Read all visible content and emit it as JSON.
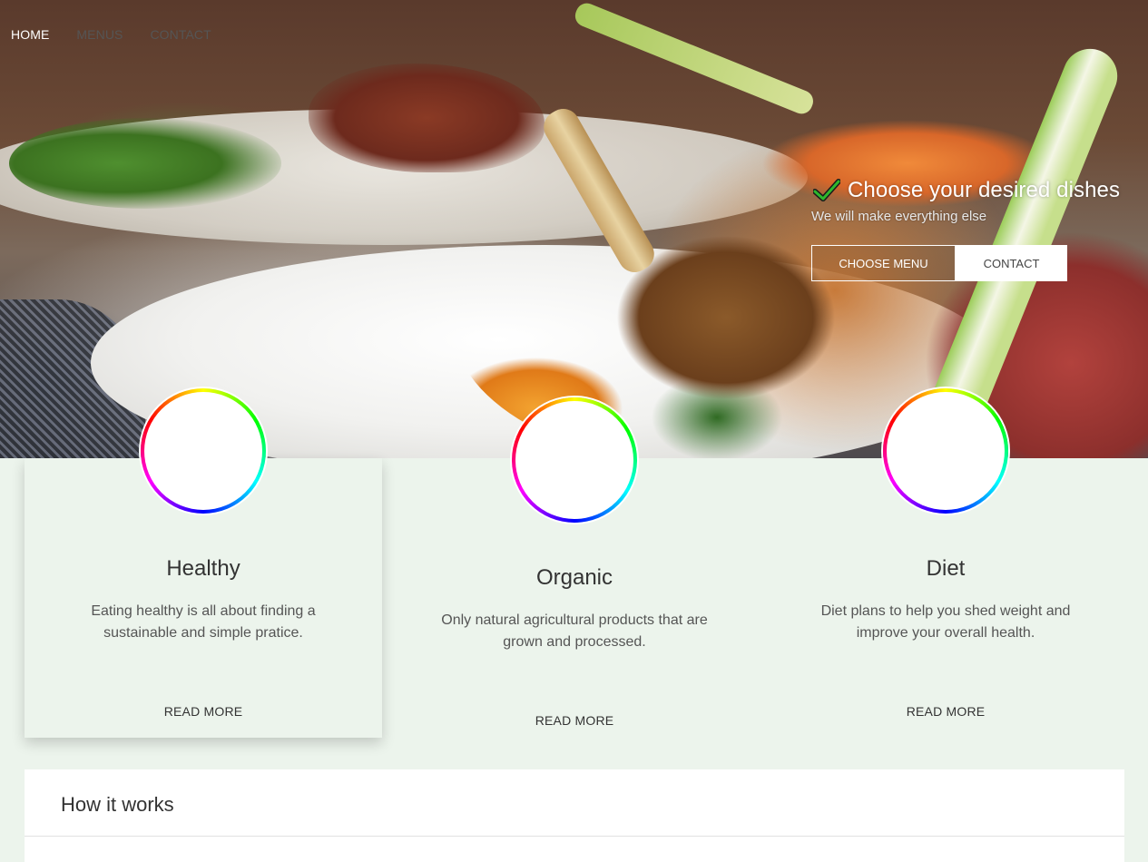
{
  "nav": {
    "items": [
      {
        "label": "HOME",
        "active": true
      },
      {
        "label": "MENUS",
        "active": false
      },
      {
        "label": "CONTACT",
        "active": false
      }
    ]
  },
  "hero": {
    "icon": "check-icon",
    "title": "Choose your desired dishes",
    "subtitle": "We will make everything else",
    "primary_button": "CHOOSE MENU",
    "secondary_button": "CONTACT"
  },
  "features": [
    {
      "title": "Healthy",
      "text": "Eating healthy is all about finding a sustainable and simple pratice.",
      "link": "READ MORE"
    },
    {
      "title": "Organic",
      "text": "Only natural agricultural products that are grown and processed.",
      "link": "READ MORE"
    },
    {
      "title": "Diet",
      "text": "Diet plans to help you shed weight and improve your overall health.",
      "link": "READ MORE"
    }
  ],
  "how_it_works": {
    "title": "How it works"
  },
  "colors": {
    "background": "#ecf4ec",
    "check": "#2db82d",
    "white": "#ffffff"
  }
}
